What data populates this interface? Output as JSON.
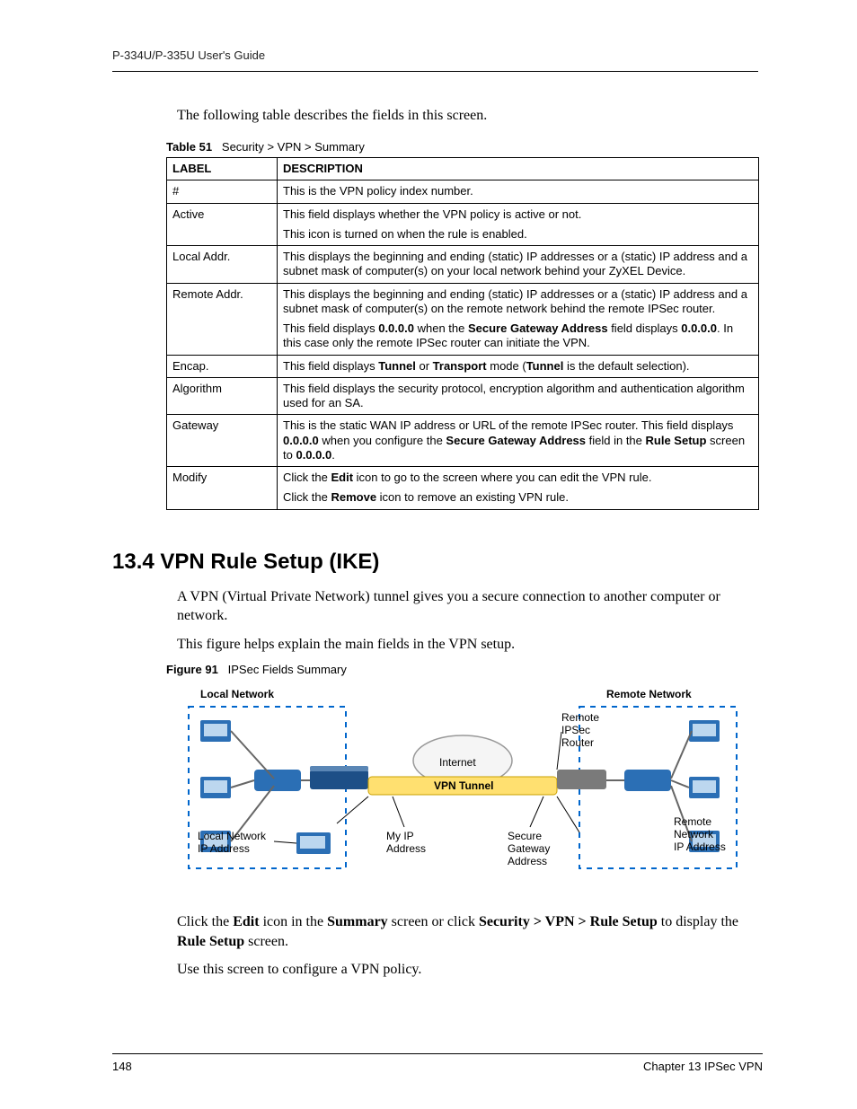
{
  "header": {
    "guide_title": "P-334U/P-335U User's Guide"
  },
  "intro": "The following table describes the fields in this screen.",
  "table_caption": {
    "label": "Table 51",
    "text": "Security > VPN > Summary"
  },
  "table": {
    "head": {
      "label": "LABEL",
      "description": "DESCRIPTION"
    },
    "rows": [
      {
        "label": "#",
        "desc": [
          "This is the VPN policy index number."
        ]
      },
      {
        "label": "Active",
        "desc": [
          "This field displays whether the VPN policy is active or not.",
          "This icon is turned on when the rule is enabled."
        ]
      },
      {
        "label": "Local Addr.",
        "desc": [
          "This displays the beginning and ending (static) IP addresses or a (static) IP address and a subnet mask of computer(s) on your local network behind your ZyXEL Device."
        ]
      },
      {
        "label": "Remote Addr.",
        "desc": [
          "This displays the beginning and ending (static) IP addresses or a (static) IP address and a subnet mask of computer(s) on the remote network behind the remote IPSec router.",
          {
            "rich": [
              "This field displays ",
              {
                "b": "0.0.0.0"
              },
              " when the ",
              {
                "b": "Secure Gateway Address"
              },
              " field displays ",
              {
                "b": "0.0.0.0"
              },
              ". In this case only the remote IPSec router can initiate the VPN."
            ]
          }
        ]
      },
      {
        "label": "Encap.",
        "desc": [
          {
            "rich": [
              "This field displays ",
              {
                "b": "Tunnel"
              },
              " or ",
              {
                "b": "Transport"
              },
              " mode (",
              {
                "b": "Tunnel"
              },
              " is the default selection)."
            ]
          }
        ]
      },
      {
        "label": "Algorithm",
        "desc": [
          "This field displays the security protocol, encryption algorithm and authentication algorithm used for an SA."
        ]
      },
      {
        "label": "Gateway",
        "desc": [
          {
            "rich": [
              "This is the static WAN IP address or URL of the remote IPSec router. This field displays ",
              {
                "b": "0.0.0.0"
              },
              " when you configure the ",
              {
                "b": "Secure Gateway Address"
              },
              " field in the ",
              {
                "b": "Rule Setup"
              },
              " screen to ",
              {
                "b": "0.0.0.0"
              },
              "."
            ]
          }
        ]
      },
      {
        "label": "Modify",
        "desc": [
          {
            "rich": [
              "Click the ",
              {
                "b": "Edit"
              },
              " icon to go to the screen where you can edit the VPN rule."
            ]
          },
          {
            "rich": [
              "Click the ",
              {
                "b": "Remove"
              },
              " icon to remove an existing VPN rule."
            ]
          }
        ]
      }
    ]
  },
  "section": {
    "heading": "13.4  VPN Rule Setup (IKE)",
    "p1": "A VPN (Virtual Private Network) tunnel gives you a secure connection to another computer or network.",
    "p2": "This figure helps explain the main fields in the VPN setup.",
    "fig_caption": {
      "label": "Figure 91",
      "text": "IPSec Fields Summary"
    },
    "figure_labels": {
      "local_network": "Local Network",
      "remote_network": "Remote Network",
      "internet": "Internet",
      "vpn_tunnel": "VPN Tunnel",
      "remote_ipsec_router": "Remote IPSec Router",
      "local_net_ip": "Local Network IP Address",
      "my_ip": "My IP Address",
      "secure_gw": "Secure Gateway Address",
      "remote_net_ip": "Remote Network IP Address"
    },
    "p3": {
      "rich": [
        "Click the ",
        {
          "b": "Edit"
        },
        " icon in the ",
        {
          "b": "Summary"
        },
        " screen or click ",
        {
          "b": "Security > VPN > Rule Setup"
        },
        " to display the ",
        {
          "b": "Rule Setup"
        },
        " screen."
      ]
    },
    "p4": "Use this screen to configure a VPN policy."
  },
  "footer": {
    "page_num": "148",
    "chapter": "Chapter 13 IPSec VPN"
  }
}
